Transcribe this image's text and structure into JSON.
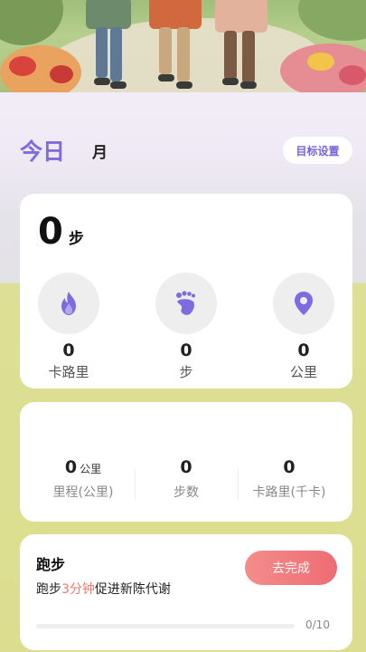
{
  "tabs": {
    "today": "今日",
    "month": "月"
  },
  "goal_button": "目标设置",
  "today_card": {
    "steps_value": "0",
    "steps_unit": "步",
    "stats": [
      {
        "icon": "flame-icon",
        "value": "0",
        "label": "卡路里",
        "color": "#7e6be0"
      },
      {
        "icon": "footprint-icon",
        "value": "0",
        "label": "步",
        "color": "#7e6be0"
      },
      {
        "icon": "location-pin-icon",
        "value": "0",
        "label": "公里",
        "color": "#7e6be0"
      }
    ]
  },
  "summary_card": {
    "distance": {
      "value": "0",
      "unit": "公里",
      "label": "里程(公里)"
    },
    "steps": {
      "value": "0",
      "label": "步数"
    },
    "calories": {
      "value": "0",
      "label": "卡路里(千卡)"
    }
  },
  "task_card": {
    "title": "跑步",
    "desc_prefix": "跑步",
    "desc_highlight": "3分钟",
    "desc_suffix": "促进新陈代谢",
    "button": "去完成",
    "progress_text": "0/10",
    "progress_fraction": 0
  },
  "colors": {
    "accent": "#7e6be0",
    "button_gradient_start": "#f48d8a",
    "button_gradient_end": "#ee6c74"
  }
}
